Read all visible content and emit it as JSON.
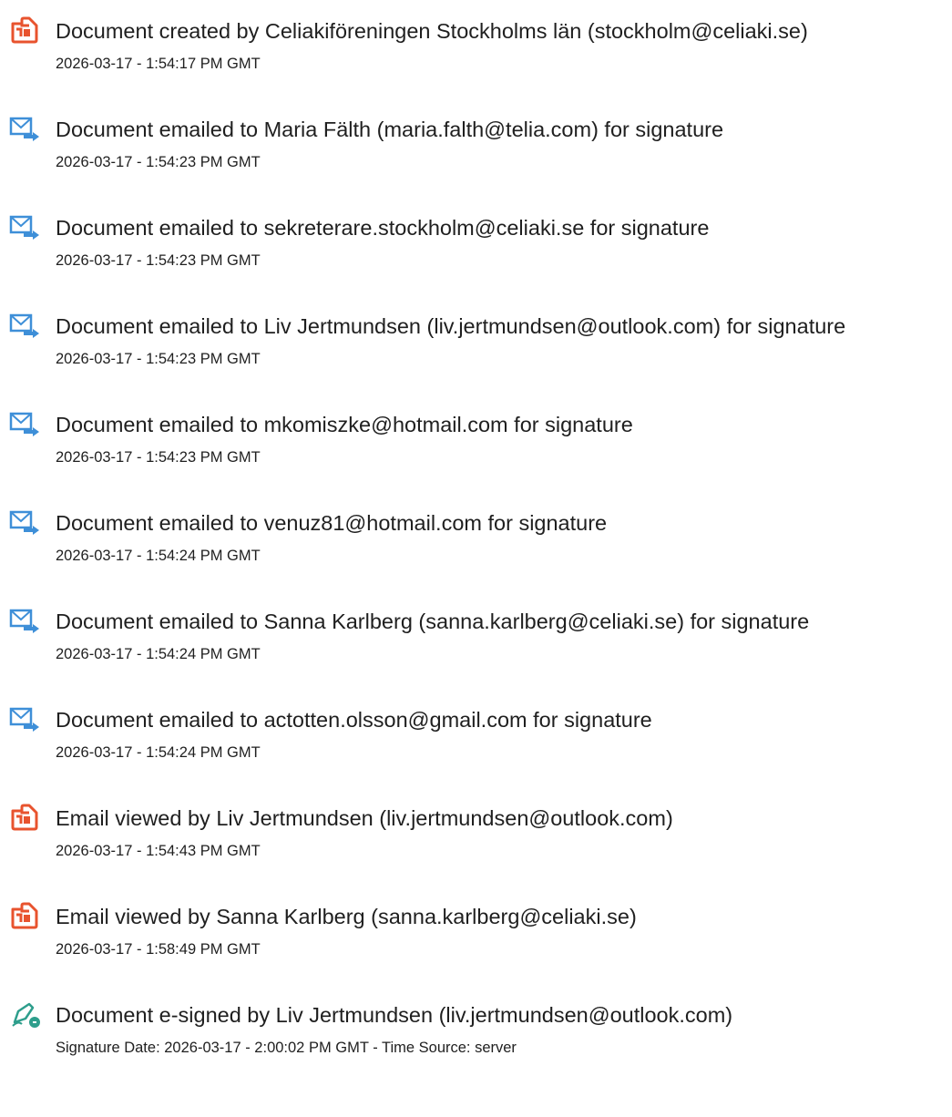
{
  "events": [
    {
      "icon": "document-created-icon",
      "title": "Document created by Celiakiföreningen Stockholms län (stockholm@celiaki.se)",
      "timestamp": "2026-03-17 - 1:54:17 PM GMT"
    },
    {
      "icon": "document-emailed-icon",
      "title": "Document emailed to Maria Fälth (maria.falth@telia.com) for signature",
      "timestamp": "2026-03-17 - 1:54:23 PM GMT"
    },
    {
      "icon": "document-emailed-icon",
      "title": "Document emailed to sekreterare.stockholm@celiaki.se for signature",
      "timestamp": "2026-03-17 - 1:54:23 PM GMT"
    },
    {
      "icon": "document-emailed-icon",
      "title": "Document emailed to Liv Jertmundsen (liv.jertmundsen@outlook.com) for signature",
      "timestamp": "2026-03-17 - 1:54:23 PM GMT"
    },
    {
      "icon": "document-emailed-icon",
      "title": "Document emailed to mkomiszke@hotmail.com for signature",
      "timestamp": "2026-03-17 - 1:54:23 PM GMT"
    },
    {
      "icon": "document-emailed-icon",
      "title": "Document emailed to venuz81@hotmail.com for signature",
      "timestamp": "2026-03-17 - 1:54:24 PM GMT"
    },
    {
      "icon": "document-emailed-icon",
      "title": "Document emailed to Sanna Karlberg (sanna.karlberg@celiaki.se) for signature",
      "timestamp": "2026-03-17 - 1:54:24 PM GMT"
    },
    {
      "icon": "document-emailed-icon",
      "title": "Document emailed to actotten.olsson@gmail.com for signature",
      "timestamp": "2026-03-17 - 1:54:24 PM GMT"
    },
    {
      "icon": "email-viewed-icon",
      "title": "Email viewed by Liv Jertmundsen (liv.jertmundsen@outlook.com)",
      "timestamp": "2026-03-17 - 1:54:43 PM GMT"
    },
    {
      "icon": "email-viewed-icon",
      "title": "Email viewed by Sanna Karlberg (sanna.karlberg@celiaki.se)",
      "timestamp": "2026-03-17 - 1:58:49 PM GMT"
    },
    {
      "icon": "e-signed-icon",
      "title": "Document e-signed by Liv Jertmundsen (liv.jertmundsen@outlook.com)",
      "timestamp": "Signature Date: 2026-03-17 - 2:00:02 PM GMT - Time Source: server"
    }
  ],
  "colors": {
    "text": "#1f1f1f",
    "document_icon": "#e8532e",
    "email_icon": "#3e8fd8",
    "sign_icon": "#2e9e8c"
  }
}
